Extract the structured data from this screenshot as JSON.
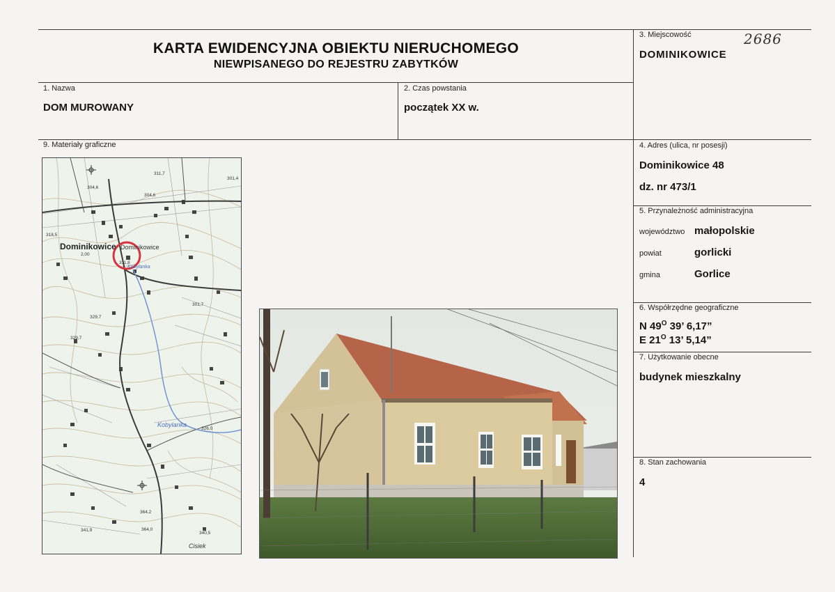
{
  "header": {
    "title": "KARTA EWIDENCYJNA OBIEKTU NIERUCHOMEGO",
    "subtitle": "NIEWPISANEGO DO REJESTRU ZABYTKÓW",
    "handwritten_number": "2686"
  },
  "fields": {
    "miejscowosc": {
      "label": "3. Miejscowość",
      "value": "DOMINIKOWICE"
    },
    "nazwa": {
      "label": "1. Nazwa",
      "value": "DOM MUROWANY"
    },
    "czas": {
      "label": "2. Czas powstania",
      "value": "początek XX w."
    },
    "materialy": {
      "label": "9. Materiały graficzne"
    },
    "adres": {
      "label": "4. Adres (ulica, nr posesji)",
      "line1": "Dominikowice 48",
      "line2": "dz. nr 473/1"
    },
    "przynaleznosc": {
      "label": "5. Przynależność administracyjna",
      "woj_label": "województwo",
      "woj_value": "małopolskie",
      "powiat_label": "powiat",
      "powiat_value": "gorlicki",
      "gmina_label": "gmina",
      "gmina_value": "Gorlice"
    },
    "wspolrzedne": {
      "label": "6. Współrzędne geograficzne",
      "n_prefix": "N 49",
      "n_deg": "O",
      "n_rest": " 39’ 6,17”",
      "e_prefix": "E 21",
      "e_deg": "O",
      "e_rest": " 13’ 5,14”"
    },
    "uzytkowanie": {
      "label": "7. Użytkowanie obecne",
      "value": "budynek mieszkalny"
    },
    "stan": {
      "label": "8. Stan zachowania",
      "value": "4"
    }
  },
  "map": {
    "place_label": "Dominikowice",
    "place_label_small": "Dominikowice",
    "stream_label": "Kobylanka",
    "stream_label_small": "Kobylanka",
    "corner_label": "Cisiek",
    "elevations": [
      "311,7",
      "301,4",
      "304,6",
      "304,6",
      "318,5",
      "2,00",
      "311,8",
      "329,7",
      "329,7",
      "326,0",
      "364,2",
      "341,9",
      "364,0",
      "340,5",
      "301,7"
    ]
  },
  "colors": {
    "map_background": "#eef3ec",
    "map_contours": "#b7a88c",
    "map_roads": "#3b3b3b",
    "map_water": "#6b8fd4",
    "map_circle": "#d8333c",
    "photo_sky": "#e7ebe6",
    "photo_wall": "#d9c9a0",
    "photo_roof": "#b8664a",
    "photo_grass": "#4d6b35"
  }
}
